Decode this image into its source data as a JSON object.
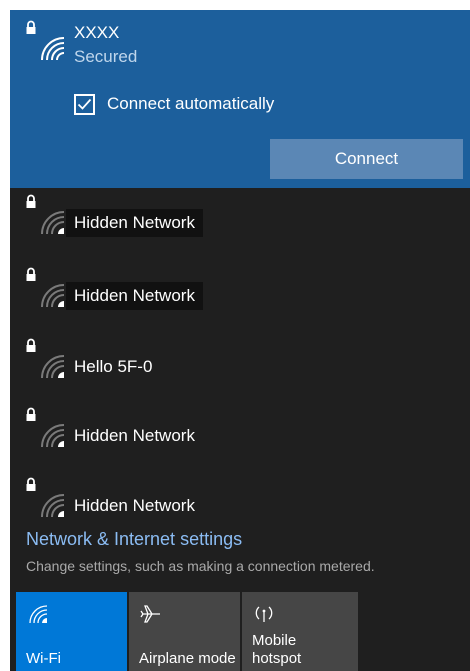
{
  "selected_network": {
    "name": "XXXX",
    "status": "Secured",
    "connect_automatically_label": "Connect automatically",
    "connect_automatically_checked": true,
    "connect_label": "Connect"
  },
  "networks": [
    {
      "name": "Hidden Network",
      "icon": "wifi-secured-icon"
    },
    {
      "name": "Hidden Network",
      "icon": "wifi-secured-icon"
    },
    {
      "name": "Hello 5F-0",
      "icon": "wifi-secured-icon"
    },
    {
      "name": "Hidden Network",
      "icon": "wifi-secured-icon"
    },
    {
      "name": "Hidden Network",
      "icon": "wifi-secured-icon"
    }
  ],
  "settings": {
    "link": "Network & Internet settings",
    "description": "Change settings, such as making a connection metered."
  },
  "quick_actions": [
    {
      "label": "Wi-Fi",
      "icon": "wifi-icon",
      "active": true
    },
    {
      "label": "Airplane mode",
      "icon": "airplane-icon",
      "active": false
    },
    {
      "label_line1": "Mobile",
      "label_line2": "hotspot",
      "icon": "hotspot-icon",
      "active": false
    }
  ],
  "colors": {
    "accent": "#0078d7",
    "selected_bg": "#1c5f9c",
    "panel_bg": "#1f1f1f",
    "link": "#8bbcf3"
  }
}
